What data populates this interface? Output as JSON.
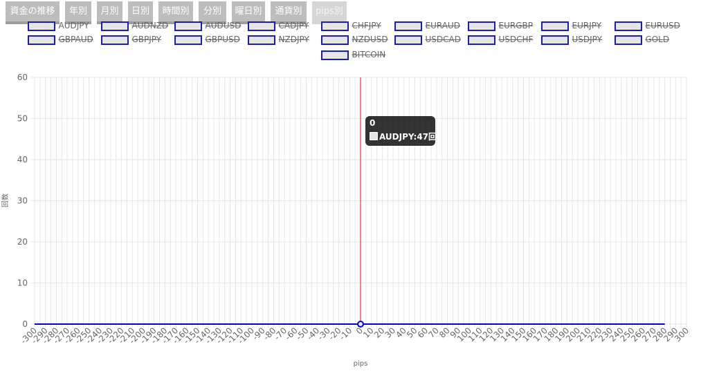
{
  "tabs": [
    {
      "label": "資金の推移",
      "active": false
    },
    {
      "label": "年別",
      "active": false
    },
    {
      "label": "月別",
      "active": false
    },
    {
      "label": "日別",
      "active": false
    },
    {
      "label": "時間別",
      "active": false
    },
    {
      "label": "分別",
      "active": false
    },
    {
      "label": "曜日別",
      "active": false
    },
    {
      "label": "通貨別",
      "active": false
    },
    {
      "label": "pips別",
      "active": true
    }
  ],
  "legend": [
    {
      "label": "AUDJPY",
      "hidden": false
    },
    {
      "label": "AUDNZD",
      "hidden": true
    },
    {
      "label": "AUDUSD",
      "hidden": true
    },
    {
      "label": "CADJPY",
      "hidden": true
    },
    {
      "label": "CHFJPY",
      "hidden": true
    },
    {
      "label": "EURAUD",
      "hidden": true
    },
    {
      "label": "EURGBP",
      "hidden": true
    },
    {
      "label": "EURJPY",
      "hidden": true
    },
    {
      "label": "EURUSD",
      "hidden": true
    },
    {
      "label": "GBPAUD",
      "hidden": true
    },
    {
      "label": "GBPJPY",
      "hidden": true
    },
    {
      "label": "GBPUSD",
      "hidden": true
    },
    {
      "label": "NZDJPY",
      "hidden": true
    },
    {
      "label": "NZDUSD",
      "hidden": true
    },
    {
      "label": "USDCAD",
      "hidden": true
    },
    {
      "label": "USDCHF",
      "hidden": true
    },
    {
      "label": "USDJPY",
      "hidden": true
    },
    {
      "label": "GOLD",
      "hidden": true
    },
    {
      "label": "BITCOIN",
      "hidden": true
    }
  ],
  "tooltip": {
    "title": "0",
    "body": "AUDJPY:47回"
  },
  "colors": {
    "series": "#0000e0",
    "marker_line": "#ff0000",
    "grid": "#e6e6e6"
  },
  "chart_data": {
    "type": "line",
    "xlabel": "pips",
    "ylabel": "回数",
    "xlim": [
      -300,
      300
    ],
    "ylim": [
      0,
      60
    ],
    "yticks": [
      0,
      10,
      20,
      30,
      40,
      50,
      60
    ],
    "xticks": [
      -300,
      -290,
      -280,
      -270,
      -260,
      -250,
      -240,
      -230,
      -220,
      -210,
      -200,
      -190,
      -180,
      -170,
      -160,
      -150,
      -140,
      -130,
      -120,
      -110,
      -100,
      -90,
      -80,
      -70,
      -60,
      -50,
      -40,
      -30,
      -20,
      -10,
      0,
      10,
      20,
      30,
      40,
      50,
      60,
      70,
      80,
      90,
      100,
      110,
      120,
      130,
      140,
      150,
      160,
      170,
      180,
      190,
      200,
      210,
      220,
      230,
      240,
      250,
      260,
      270,
      280,
      290,
      300
    ],
    "grid": true,
    "highlight_x": 0,
    "series": [
      {
        "name": "AUDJPY",
        "x_start": -300,
        "x_step": 1,
        "values": [
          0,
          0,
          0,
          0,
          0,
          0,
          0,
          0,
          0,
          0,
          0,
          0,
          0,
          0,
          0,
          0,
          0,
          0,
          0,
          0,
          0,
          0,
          0,
          0,
          0,
          0,
          0,
          0,
          0,
          0,
          0,
          0,
          0,
          0,
          0,
          0,
          0,
          0,
          0,
          0,
          0,
          0,
          0,
          0,
          0,
          0,
          0,
          0,
          0,
          0,
          0,
          0,
          0,
          0,
          0,
          0,
          0,
          0,
          0,
          0,
          0,
          0,
          0,
          0,
          0,
          0,
          0,
          0,
          0,
          0,
          0,
          0,
          0,
          0,
          0,
          0,
          0,
          0,
          0,
          0,
          0,
          0,
          0,
          0,
          0,
          0,
          0,
          0,
          0,
          0,
          0,
          0,
          0,
          0,
          0,
          0,
          0,
          0,
          0,
          0,
          0,
          0,
          0,
          0,
          0,
          0,
          0,
          0,
          0,
          0,
          0,
          0,
          0,
          0,
          0,
          0,
          0,
          0,
          0,
          0,
          0,
          0,
          0,
          0,
          0,
          0,
          0,
          0,
          0,
          0,
          0,
          0,
          0,
          0,
          0,
          0,
          0,
          0,
          0,
          0,
          0,
          0,
          0,
          0,
          0,
          0,
          0,
          0,
          0,
          0,
          0,
          0,
          0,
          0,
          0,
          0,
          0,
          0,
          0,
          0,
          0,
          0,
          0,
          0,
          0,
          0,
          0,
          0,
          0,
          0,
          0,
          0,
          0,
          0,
          0,
          0,
          0,
          0,
          0,
          0,
          0,
          0,
          0,
          0,
          0,
          0,
          0,
          0,
          0,
          0,
          0,
          0,
          0,
          0,
          0,
          0,
          0,
          0,
          0,
          0,
          0,
          0,
          0,
          0,
          0,
          0,
          0,
          0,
          0,
          0,
          0,
          0,
          0,
          0,
          0,
          0,
          0,
          0,
          0,
          0,
          0,
          0,
          0,
          0,
          0,
          0,
          0,
          0,
          0,
          0,
          0,
          0,
          0,
          0,
          0,
          0,
          0,
          0,
          0,
          0,
          0,
          0,
          0,
          0,
          0,
          0,
          0,
          0,
          0,
          0,
          0,
          0,
          0,
          0,
          0,
          0,
          0,
          0,
          0,
          0,
          0,
          0,
          0,
          0,
          0,
          0,
          0,
          0,
          0,
          0,
          0,
          0,
          0,
          0,
          0,
          0,
          0,
          0,
          0,
          0,
          0,
          0,
          0,
          0,
          0,
          0,
          0,
          0,
          0,
          0,
          0,
          0,
          0,
          0,
          0,
          0,
          0,
          0,
          0,
          0,
          0,
          0,
          0,
          0,
          0,
          0,
          0,
          0,
          0,
          0,
          0,
          0,
          0,
          0,
          0,
          0,
          0,
          0,
          0,
          0,
          0,
          0,
          0,
          0,
          0,
          0,
          0,
          0,
          0,
          0,
          0,
          0,
          0,
          0,
          0,
          0,
          0,
          0,
          0,
          0,
          0,
          0,
          0,
          0,
          0,
          0,
          0,
          0,
          0,
          0,
          0,
          0,
          0,
          0,
          0,
          0,
          0,
          0,
          0,
          0,
          0,
          0,
          0,
          0,
          0,
          0,
          0,
          0,
          0,
          0,
          0,
          0,
          0,
          0,
          0,
          0,
          0,
          0,
          0,
          0,
          0,
          0,
          0,
          0,
          0,
          0,
          0,
          0,
          0,
          0,
          0,
          0,
          0,
          0,
          0,
          0,
          0,
          0,
          0,
          0,
          0,
          0,
          0,
          0,
          0,
          0,
          0,
          0,
          0,
          0,
          0,
          0,
          0,
          0,
          0,
          0,
          0,
          0,
          0,
          0,
          0,
          0,
          0,
          0,
          0,
          0,
          0,
          0,
          0,
          0,
          0,
          0,
          0,
          0,
          0,
          0,
          0,
          0,
          0,
          0,
          0,
          0,
          0,
          0,
          0,
          0,
          0,
          0,
          0,
          0,
          0,
          0,
          0,
          0,
          0,
          0,
          0,
          0,
          0,
          0,
          0,
          0,
          0,
          0,
          0,
          0,
          0,
          0,
          0,
          0,
          0,
          0,
          0,
          0,
          0,
          0,
          0,
          0,
          0,
          0,
          0,
          0,
          0,
          0,
          0,
          0,
          0,
          0,
          0,
          0,
          0,
          0,
          0,
          0,
          0,
          0,
          0,
          0,
          0,
          0,
          0,
          0,
          0,
          0,
          0,
          0,
          0,
          0,
          0,
          0,
          0,
          0,
          0,
          0,
          0,
          0,
          0,
          0,
          0,
          0,
          0,
          0,
          0,
          0,
          0,
          0,
          0,
          0,
          0,
          0,
          0,
          0,
          0,
          0,
          0,
          0,
          0,
          0,
          0,
          0,
          0,
          0,
          0,
          0,
          0,
          0,
          0,
          0,
          0,
          0,
          0,
          0,
          0,
          0,
          0,
          0,
          0,
          0,
          0,
          0,
          0,
          0,
          0,
          0,
          0,
          0,
          0,
          0,
          0,
          0,
          0,
          0,
          0,
          0,
          0,
          0,
          0,
          0,
          0,
          0,
          0
        ]
      }
    ]
  }
}
